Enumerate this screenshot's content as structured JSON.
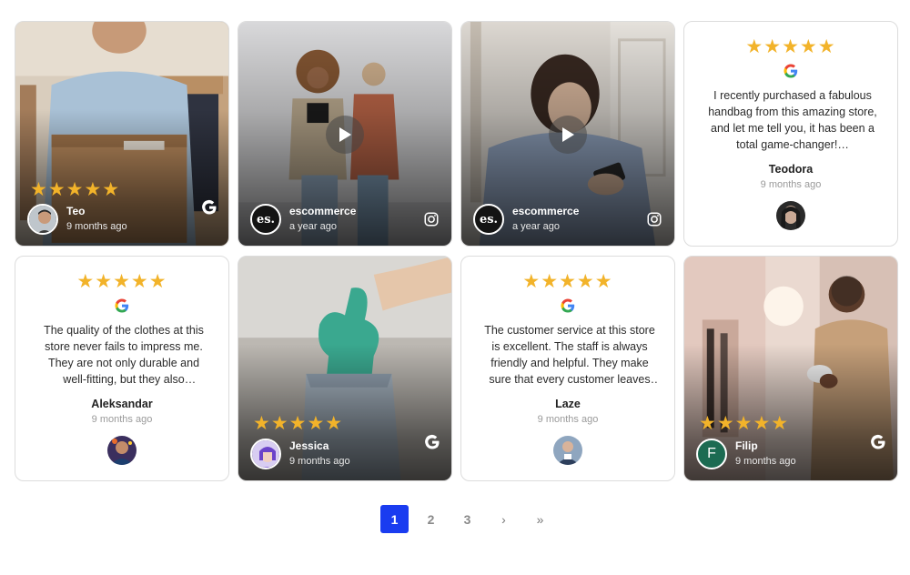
{
  "cards": [
    {
      "type": "photo",
      "stars": "★★★★★",
      "author": "Teo",
      "time": "9 months ago",
      "source_icon": "google-icon"
    },
    {
      "type": "video",
      "author": "escommerce",
      "avatar_text": "es.",
      "time": "a year ago",
      "source_icon": "instagram-icon"
    },
    {
      "type": "video",
      "author": "escommerce",
      "avatar_text": "es.",
      "time": "a year ago",
      "source_icon": "instagram-icon"
    },
    {
      "type": "text",
      "stars": "★★★★★",
      "text": "I recently purchased a fabulous handbag from this amazing store, and let me tell you, it has been a total game-changer!…",
      "author": "Teodora",
      "time": "9 months ago"
    },
    {
      "type": "text",
      "stars": "★★★★★",
      "text": "The quality of the clothes at this store never fails to impress me. They are not only durable and well-fitting, but they also consistently exceed my expectations.",
      "author": "Aleksandar",
      "time": "9 months ago"
    },
    {
      "type": "photo",
      "stars": "★★★★★",
      "author": "Jessica",
      "time": "9 months ago",
      "source_icon": "google-icon"
    },
    {
      "type": "text",
      "stars": "★★★★★",
      "text": "The customer service at this store is excellent. The staff is always friendly and helpful. They make sure that every customer leaves the store satisfied.",
      "author": "Laze",
      "time": "9 months ago"
    },
    {
      "type": "photo",
      "stars": "★★★★★",
      "author": "Filip",
      "avatar_letter": "F",
      "time": "9 months ago",
      "source_icon": "google-icon"
    }
  ],
  "pagination": {
    "pages": [
      "1",
      "2",
      "3"
    ],
    "current": "1",
    "next": "›",
    "last": "»"
  },
  "colors": {
    "star": "#f2b32a",
    "accent": "#1a3cf0"
  }
}
